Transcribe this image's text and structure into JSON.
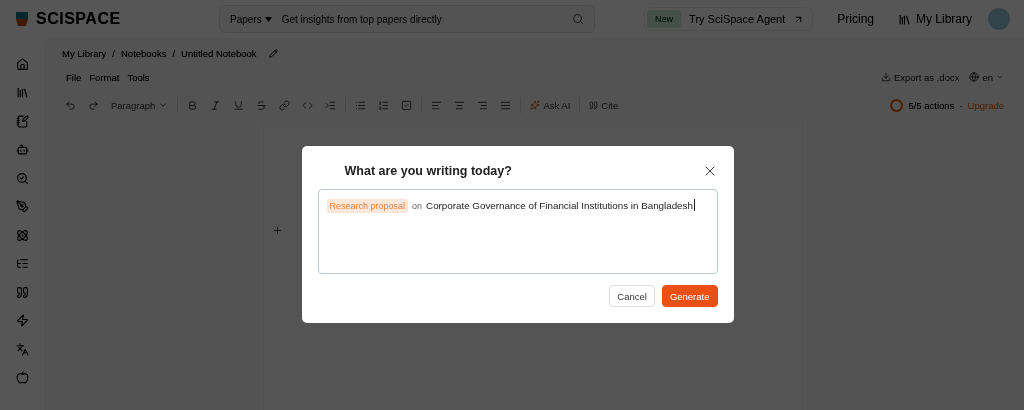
{
  "header": {
    "logo": "SCISPACE",
    "search": {
      "scope": "Papers",
      "placeholder": "Get insights from top papers directly"
    },
    "agent": {
      "badge": "New",
      "label": "Try SciSpace Agent"
    },
    "nav": [
      "Pricing",
      "My Library"
    ]
  },
  "breadcrumb": {
    "separator": "/",
    "items": [
      "My Library",
      "Notebooks",
      "Untitled Notebook"
    ]
  },
  "menu": [
    "File",
    "Format",
    "Tools"
  ],
  "export": "Export as .docx",
  "language": "en",
  "toolbar": {
    "paragraph_style": "Paragraph",
    "ask_ai": "Ask AI",
    "cite": "Cite",
    "usage": "5/5 actions",
    "dot": "·",
    "upgrade": "Upgrade"
  },
  "dialog": {
    "title": "What are you writing today?",
    "tag": "Research proposal",
    "connector": "on",
    "value": "Corporate Governance of Financial Institutions in Bangladesh",
    "buttons": [
      {
        "kind": "secondary",
        "label": "Cancel"
      },
      {
        "kind": "primary",
        "label": "Generate"
      }
    ]
  }
}
